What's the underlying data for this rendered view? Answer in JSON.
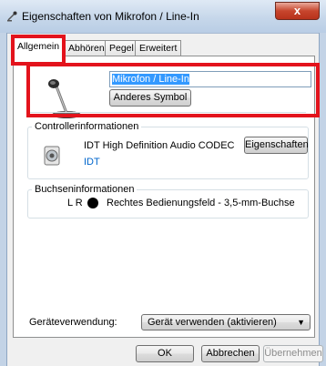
{
  "window": {
    "title": "Eigenschaften von Mikrofon / Line-In",
    "close_label": "x"
  },
  "tabs": [
    {
      "label": "Allgemein"
    },
    {
      "label": "Abhören"
    },
    {
      "label": "Pegel"
    },
    {
      "label": "Erweitert"
    }
  ],
  "device": {
    "name_value": "Mikrofon / Line-In",
    "change_icon_button": "Anderes Symbol"
  },
  "controller": {
    "heading": "Controllerinformationen",
    "name": "IDT High Definition Audio CODEC",
    "vendor": "IDT",
    "properties_button": "Eigenschaften"
  },
  "jack": {
    "heading": "Buchseninformationen",
    "channels": "L R",
    "description": "Rechtes Bedienungsfeld - 3,5-mm-Buchse"
  },
  "usage": {
    "label": "Geräteverwendung:",
    "selected": "Gerät verwenden (aktivieren)"
  },
  "buttons": {
    "ok": "OK",
    "cancel": "Abbrechen",
    "apply": "Übernehmen"
  },
  "colors": {
    "highlight": "#e3131c",
    "link": "#0066cc",
    "selection": "#3399ff"
  }
}
